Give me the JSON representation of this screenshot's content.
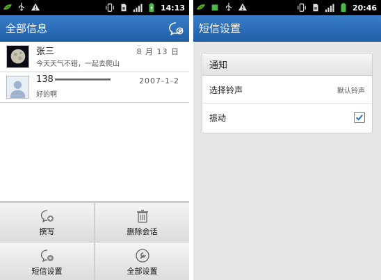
{
  "left": {
    "status": {
      "time": "14:13"
    },
    "title": "全部信息",
    "conversations": [
      {
        "name": "张三",
        "snippet": "今天天气不错，一起去爬山",
        "date": "8 月 13 日"
      },
      {
        "name": "138",
        "snippet": "好的啊",
        "date": "2007-1-2"
      }
    ],
    "menu": {
      "compose_label": "撰写",
      "delete_label": "删除会话",
      "sms_settings_label": "短信设置",
      "all_settings_label": "全部设置"
    }
  },
  "right": {
    "status": {
      "time": "20:46"
    },
    "title": "短信设置",
    "section": "通知",
    "ringtone_label": "选择铃声",
    "ringtone_value": "默认铃声",
    "vibrate_label": "振动",
    "vibrate_checked": true
  },
  "colors": {
    "title_bar": "#2a6fbe",
    "accent_check": "#1f6fb8",
    "battery_green": "#4cb748"
  }
}
